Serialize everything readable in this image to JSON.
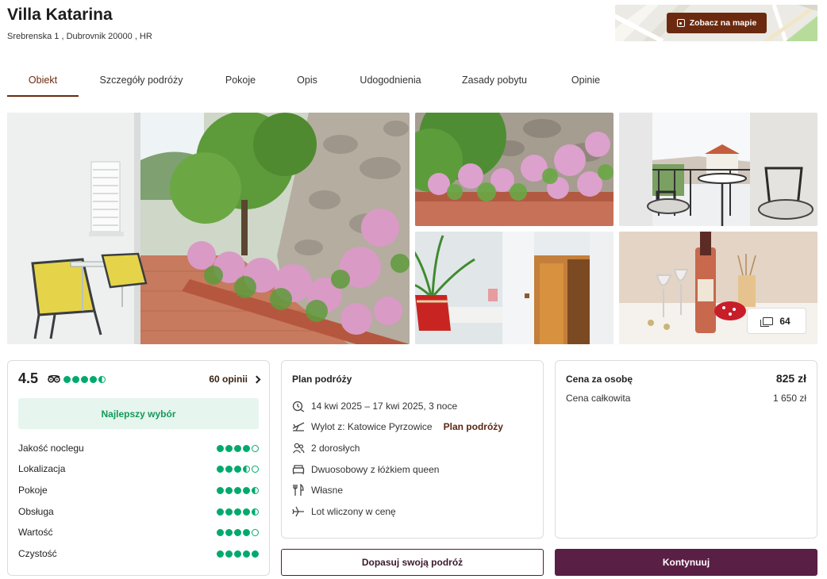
{
  "hotel": {
    "name": "Villa Katarina",
    "address": "Srebrenska 1 , Dubrovnik 20000 , HR"
  },
  "map": {
    "button_label": "Zobacz na mapie",
    "icon": "map-pin-icon"
  },
  "tabs": [
    {
      "label": "Obiekt",
      "active": true
    },
    {
      "label": "Szczegóły podróży"
    },
    {
      "label": "Pokoje"
    },
    {
      "label": "Opis"
    },
    {
      "label": "Udogodnienia"
    },
    {
      "label": "Zasady pobytu"
    },
    {
      "label": "Opinie"
    }
  ],
  "gallery": {
    "photo_count": "64",
    "icon": "gallery-icon"
  },
  "rating": {
    "score": "4.5",
    "source_icon": "tripadvisor-icon",
    "reviews_label": "60 opinii",
    "badge": "Najlepszy wybór",
    "overall_bubbles": 4.5,
    "categories": [
      {
        "label": "Jakość noclegu",
        "bubbles": 4
      },
      {
        "label": "Lokalizacja",
        "bubbles": 3.5
      },
      {
        "label": "Pokoje",
        "bubbles": 4.5
      },
      {
        "label": "Obsługa",
        "bubbles": 4.5
      },
      {
        "label": "Wartość",
        "bubbles": 4
      },
      {
        "label": "Czystość",
        "bubbles": 5
      }
    ],
    "accent_color": "#00aa6c"
  },
  "trip": {
    "title": "Plan podróży",
    "dates": "14 kwi 2025 – 17 kwi 2025, 3 noce",
    "departure": "Wylot z: Katowice Pyrzowice",
    "departure_link": "Plan podróży",
    "guests": "2 dorosłych",
    "room": "Dwuosobowy z łóżkiem queen",
    "board": "Własne",
    "flight": "Lot wliczony w cenę"
  },
  "price": {
    "title": "Cena za osobę",
    "per_person": "825 zł",
    "total_label": "Cena całkowita",
    "total": "1 650 zł"
  },
  "actions": {
    "customize": "Dopasuj swoją podróż",
    "continue": "Kontynuuj"
  },
  "colors": {
    "brand_brown": "#6b2a10",
    "primary_button": "#5a1f44",
    "badge_bg": "#e7f5ef",
    "badge_text": "#139a58"
  }
}
